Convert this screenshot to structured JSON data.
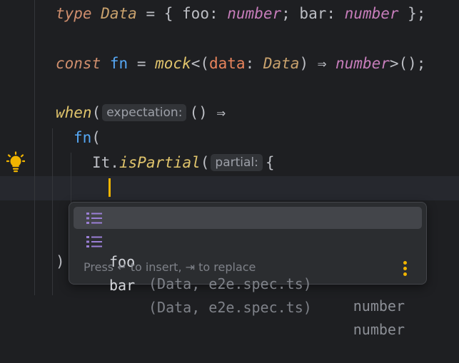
{
  "code": {
    "line1": {
      "kw": "type",
      "name": "Data",
      "eq": " = { ",
      "p1": "foo",
      "c1": ": ",
      "t1": "number",
      "sep": "; ",
      "p2": "bar",
      "c2": ": ",
      "t2": "number",
      "end": " };"
    },
    "line2": {
      "kw": "const",
      "name": "fn",
      "eq": " = ",
      "call": "mock",
      "lt": "<(",
      "param": "data",
      "colon": ": ",
      "type": "Data",
      "arrow": ") ⇒ ",
      "ret": "number",
      "end": ">();"
    },
    "line3": {
      "call": "when",
      "open": "(",
      "hint": "expectation:",
      "rest": "() ⇒"
    },
    "line4": {
      "name": "fn",
      "open": "("
    },
    "line5": {
      "obj": "It",
      "dot": ".",
      "method": "isPartial",
      "open": "(",
      "hint": "partial:",
      "rest": "{"
    },
    "line7": ")"
  },
  "completion": {
    "items": [
      {
        "name": "foo",
        "location": "(Data, e2e.spec.ts)",
        "type": "number",
        "selected": true
      },
      {
        "name": "bar",
        "location": "(Data, e2e.spec.ts)",
        "type": "number",
        "selected": false
      }
    ],
    "footer": "Press ↵ to insert, ⇥ to replace"
  },
  "icons": {
    "gutter": "lightbulb-icon",
    "item": "field-list-icon",
    "menu": "more-vertical-icon"
  },
  "colors": {
    "accent": "#f0b400",
    "background": "#1e1f22"
  }
}
